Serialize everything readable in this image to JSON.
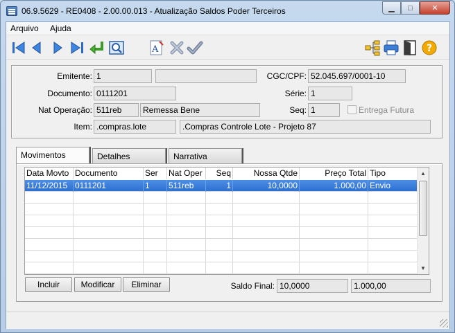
{
  "window": {
    "title": "06.9.5629 - RE0408 - 2.00.00.013 - Atualização Saldos Poder Terceiros",
    "min_symbol": "▁",
    "max_symbol": "□",
    "close_symbol": "✕"
  },
  "menu": {
    "items": [
      "Arquivo",
      "Ajuda"
    ]
  },
  "toolbar": {
    "icons": [
      "first-record-icon",
      "prev-record-icon",
      "next-record-icon",
      "last-record-icon",
      "return-icon",
      "zoom-icon",
      "font-icon",
      "cancel-icon",
      "confirm-icon",
      "tree-icon",
      "print-icon",
      "exit-icon",
      "help-icon"
    ],
    "help_label": "?"
  },
  "header": {
    "emitente_label": "Emitente:",
    "emitente_value": "1",
    "emitente_desc": "",
    "cgc_label": "CGC/CPF:",
    "cgc_value": "52.045.697/0001-10",
    "documento_label": "Documento:",
    "documento_value": "0111201",
    "serie_label": "Série:",
    "serie_value": "1",
    "nat_label": "Nat Operação:",
    "nat_value": "511reb",
    "nat_desc": "Remessa Bene",
    "seq_label": "Seq:",
    "seq_value": "1",
    "entrega_label": "Entrega Futura",
    "entrega_checked": false,
    "item_label": "Item:",
    "item_value": ".compras.lote",
    "item_desc": ".Compras Controle Lote - Projeto 87"
  },
  "tabs": [
    "Movimentos",
    "Detalhes",
    "Narrativa"
  ],
  "active_tab": "Movimentos",
  "grid": {
    "columns": [
      "Data Movto",
      "Documento",
      "Ser",
      "Nat Oper",
      "Seq",
      "Nossa Qtde",
      "Preço Total",
      "Tipo"
    ],
    "rows": [
      [
        "11/12/2015",
        "0111201",
        "1",
        "511reb",
        "1",
        "10,0000",
        "1.000,00",
        "Envio"
      ]
    ],
    "selected_row": 0
  },
  "buttons": {
    "incluir": "Incluir",
    "modificar": "Modificar",
    "eliminar": "Eliminar"
  },
  "saldo": {
    "label": "Saldo Final:",
    "qtde": "10,0000",
    "total": "1.000,00"
  },
  "colors": {
    "selection": "#3a7fdc",
    "window_frame": "#b7cde6"
  }
}
